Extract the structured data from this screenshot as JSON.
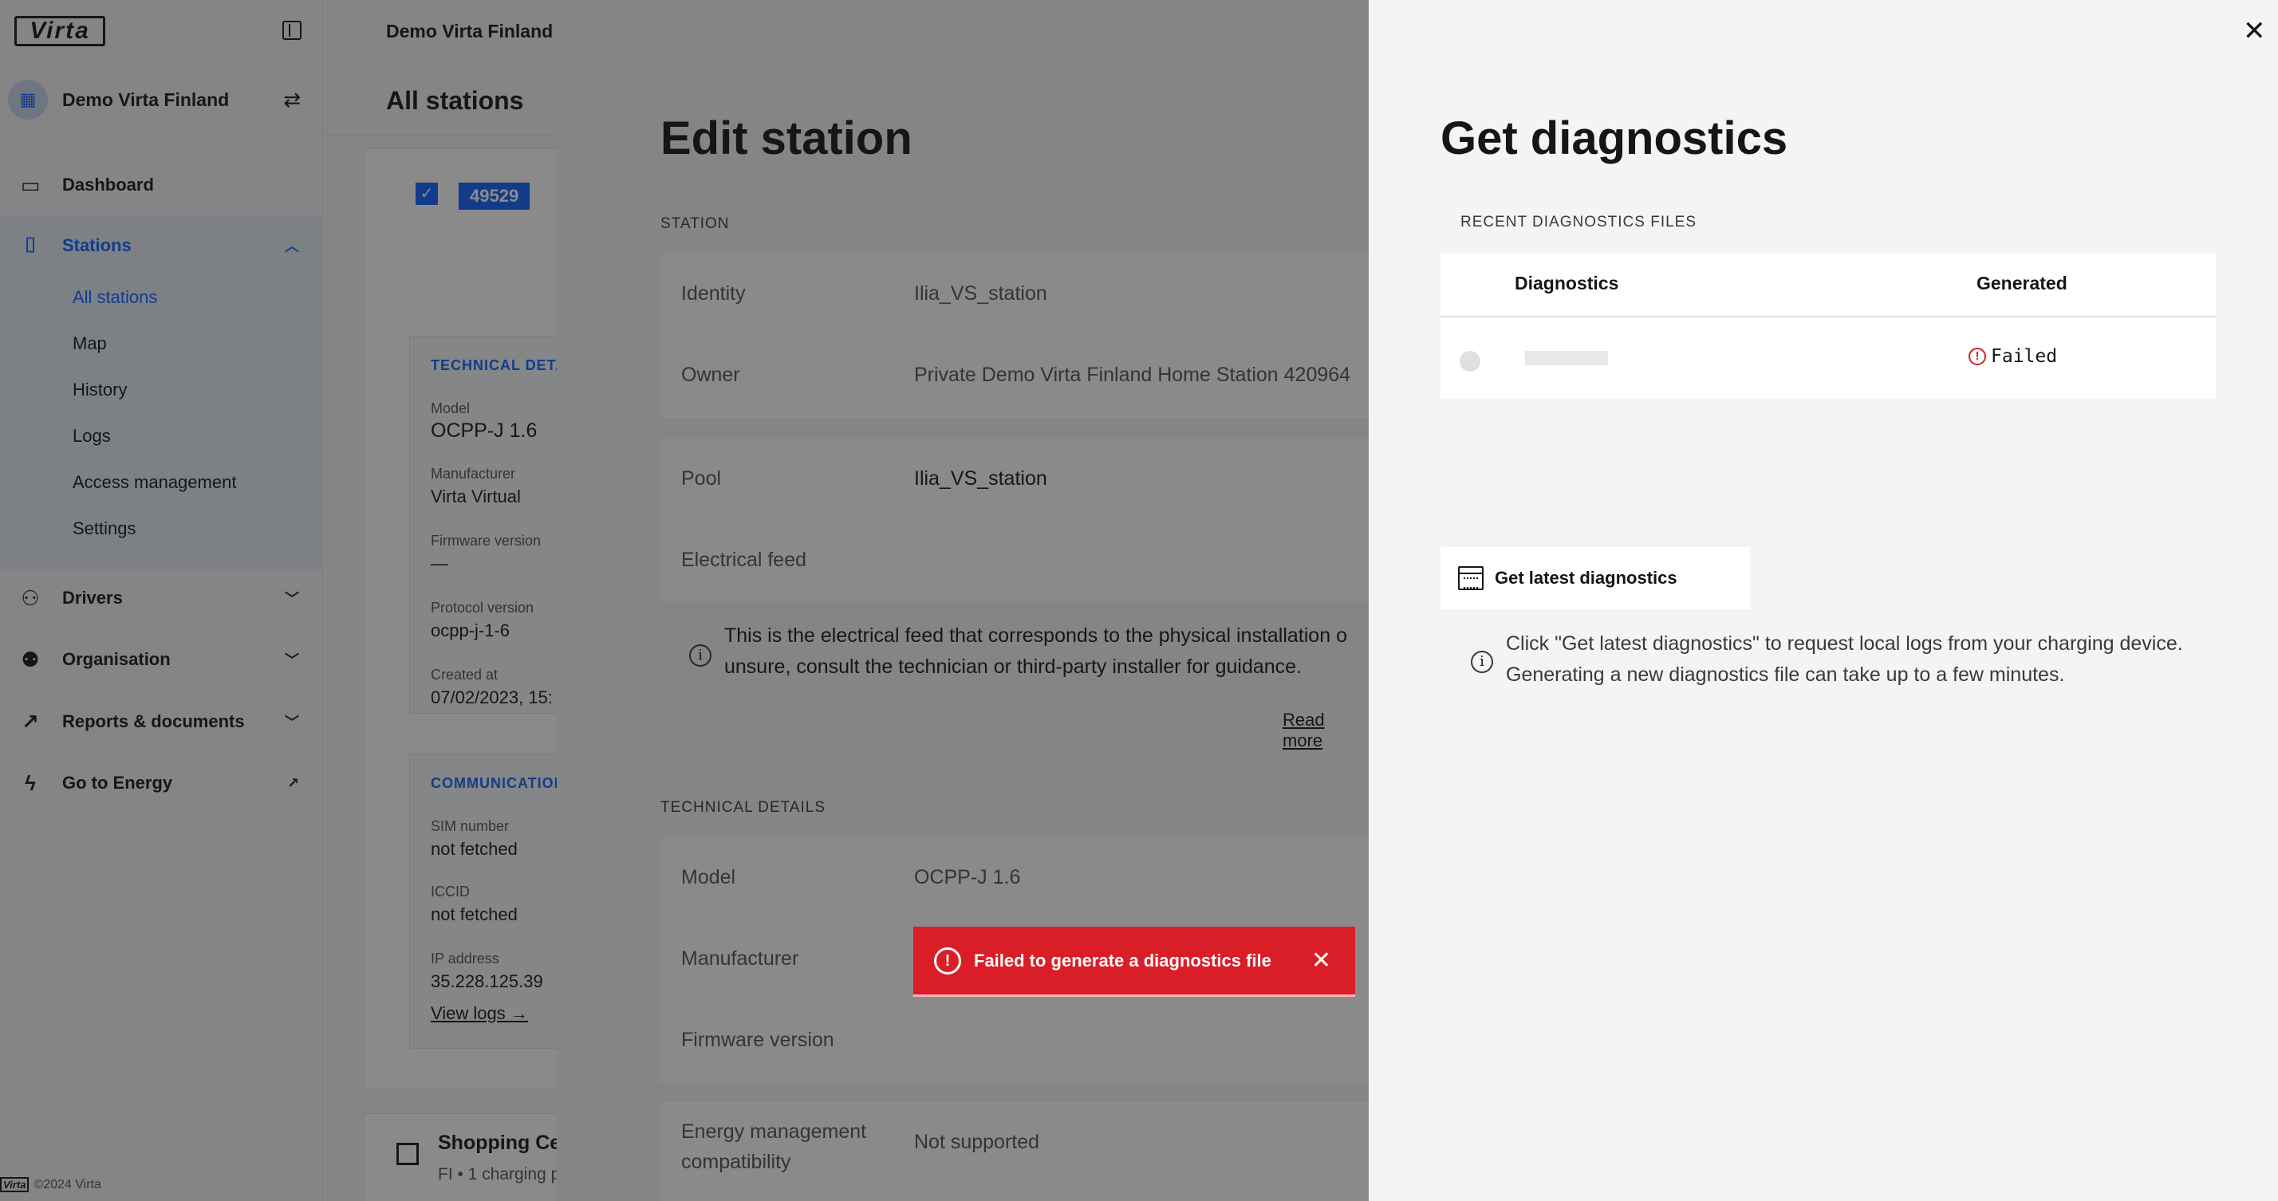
{
  "sidebar": {
    "logo": "Virta",
    "org_name": "Demo Virta Finland",
    "nav": [
      {
        "label": "Dashboard"
      },
      {
        "label": "Stations"
      },
      {
        "label": "Drivers"
      },
      {
        "label": "Organisation"
      },
      {
        "label": "Reports & documents"
      },
      {
        "label": "Go to Energy"
      }
    ],
    "subnav": [
      "All stations",
      "Map",
      "History",
      "Logs",
      "Access management",
      "Settings"
    ],
    "footer": "©2024 Virta"
  },
  "page": {
    "breadcrumb": "Demo Virta Finland (",
    "title": "All stations",
    "station_id": "49529",
    "technical": {
      "section": "TECHNICAL DETA",
      "model_label": "Model",
      "model_value": "OCPP-J 1.6",
      "manufacturer_label": "Manufacturer",
      "manufacturer_value": "Virta Virtual",
      "firmware_label": "Firmware version",
      "firmware_value": "—",
      "protocol_label": "Protocol version",
      "protocol_value": "ocpp-j-1-6",
      "created_label": "Created at",
      "created_value": "07/02/2023, 15:"
    },
    "communication": {
      "section": "COMMUNICATION",
      "sim_label": "SIM number",
      "sim_value": "not fetched",
      "iccid_label": "ICCID",
      "iccid_value": "not fetched",
      "ip_label": "IP address",
      "ip_value": "35.228.125.39",
      "view_logs": "View logs →"
    },
    "next_row": {
      "title": "Shopping Cer",
      "subtitle": "FI • 1 charging p"
    }
  },
  "edit_station": {
    "title": "Edit station",
    "section_station": "STATION",
    "identity_label": "Identity",
    "identity_value": "Ilia_VS_station",
    "owner_label": "Owner",
    "owner_value": "Private Demo Virta Finland Home Station 420964",
    "pool_label": "Pool",
    "pool_value": "Ilia_VS_station",
    "feed_label": "Electrical feed",
    "feed_info": "This is the electrical feed that corresponds to the physical installation o unsure, consult the technician or third-party installer for guidance.",
    "read_more": "Read more",
    "section_technical": "TECHNICAL DETAILS",
    "model_label": "Model",
    "model_value": "OCPP-J 1.6",
    "manufacturer_label": "Manufacturer",
    "firmware_label": "Firmware version",
    "energy_label": "Energy management compatibility",
    "energy_value": "Not supported"
  },
  "diagnostics": {
    "title": "Get diagnostics",
    "section": "RECENT DIAGNOSTICS FILES",
    "col_diagnostics": "Diagnostics",
    "col_generated": "Generated",
    "row_status": "Failed",
    "button_label": "Get latest diagnostics",
    "info": "Click \"Get latest diagnostics\" to request local logs from your charging device. Generating a new diagnostics file can take up to a few minutes."
  },
  "toast": {
    "message": "Failed to generate a diagnostics file"
  },
  "colors": {
    "accent": "#0f62fe",
    "error": "#da1e28"
  }
}
